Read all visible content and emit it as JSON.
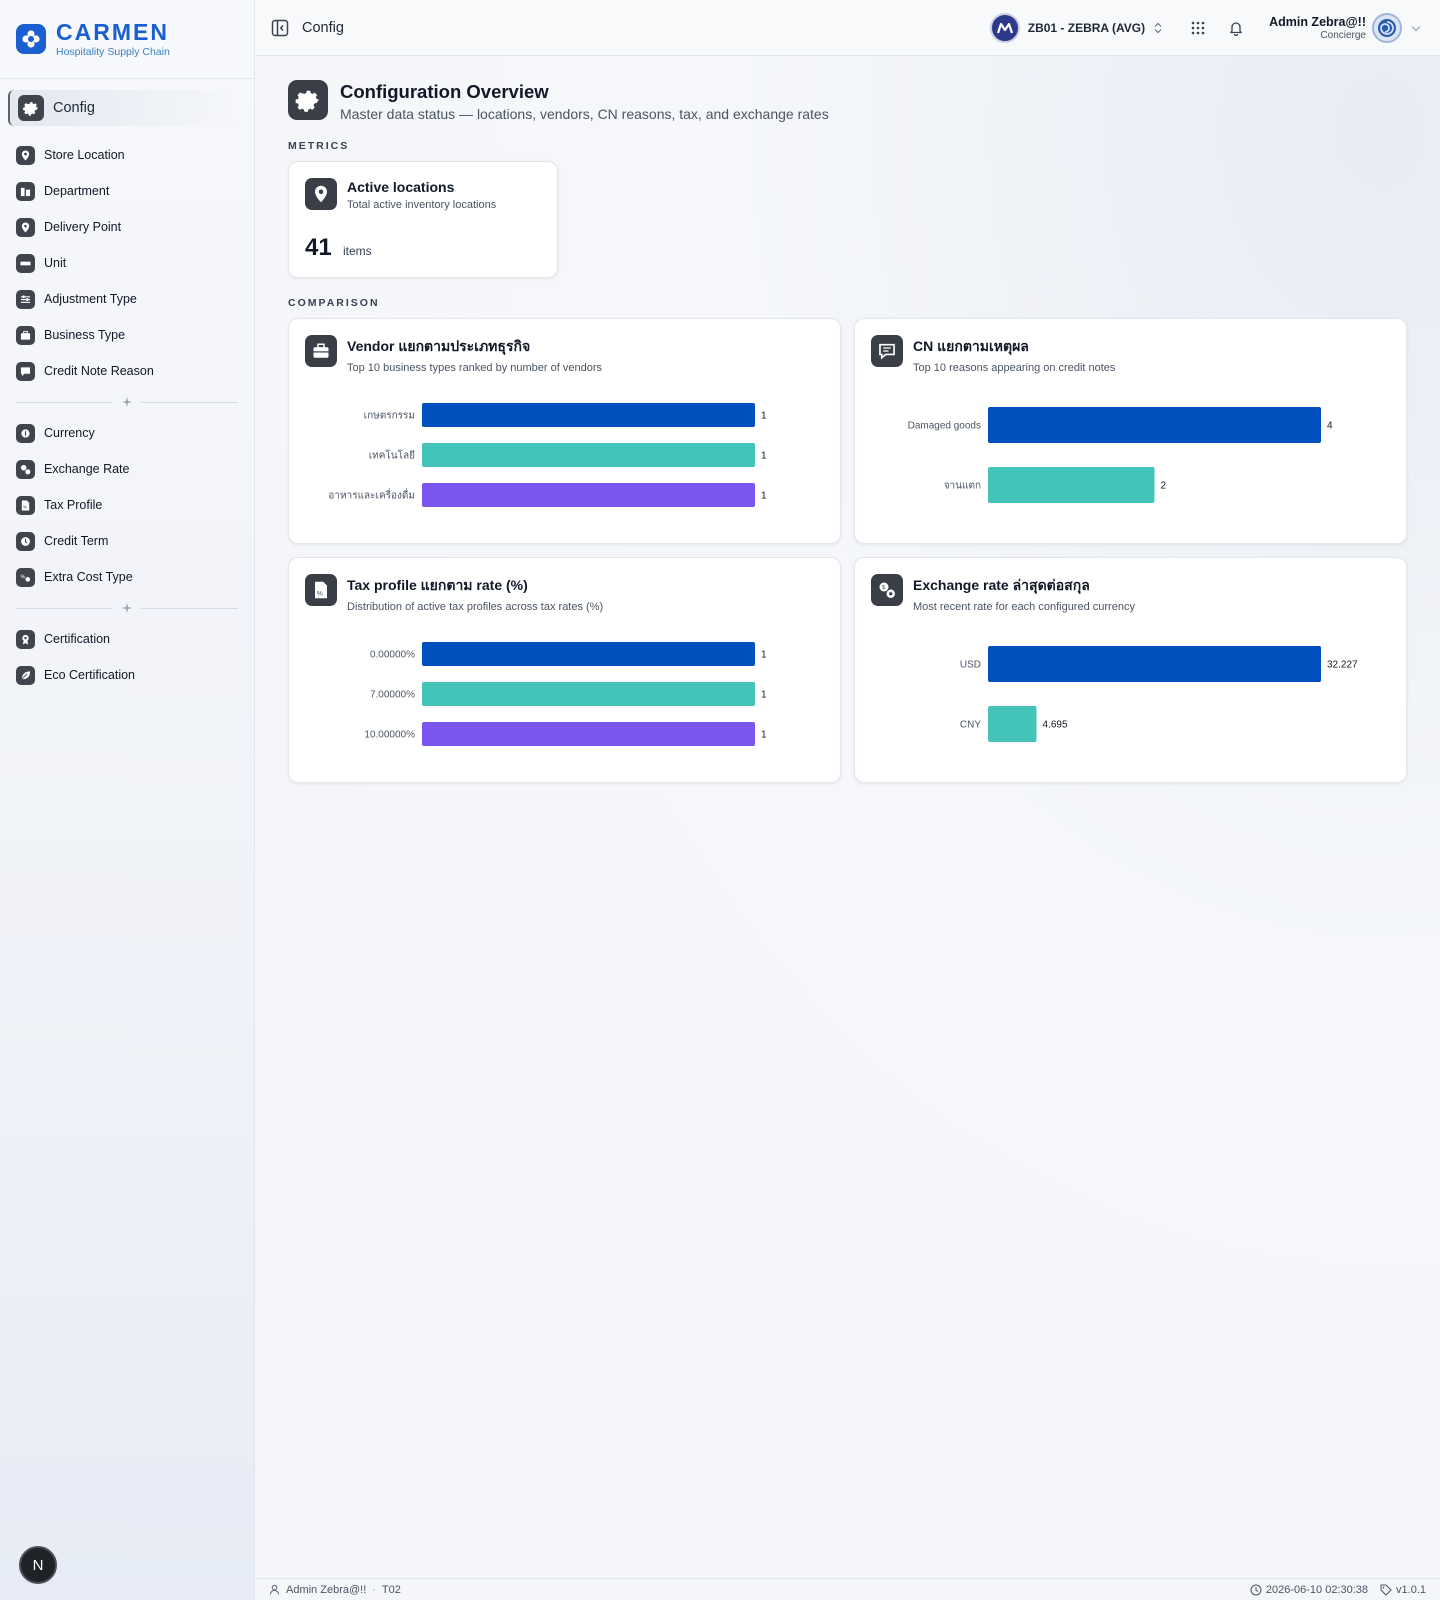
{
  "brand": {
    "name": "CARMEN",
    "tagline": "Hospitality Supply Chain"
  },
  "sidebar": {
    "active": {
      "label": "Config",
      "icon": "gear-icon"
    },
    "group1": [
      {
        "label": "Store Location",
        "icon": "map-pin-icon"
      },
      {
        "label": "Department",
        "icon": "department-icon"
      },
      {
        "label": "Delivery Point",
        "icon": "delivery-pin-icon"
      },
      {
        "label": "Unit",
        "icon": "ruler-icon"
      },
      {
        "label": "Adjustment Type",
        "icon": "sliders-icon"
      },
      {
        "label": "Business Type",
        "icon": "briefcase-icon"
      },
      {
        "label": "Credit Note Reason",
        "icon": "message-icon"
      }
    ],
    "group2": [
      {
        "label": "Currency",
        "icon": "coin-icon"
      },
      {
        "label": "Exchange Rate",
        "icon": "exchange-icon"
      },
      {
        "label": "Tax Profile",
        "icon": "percent-file-icon"
      },
      {
        "label": "Credit Term",
        "icon": "clock-icon"
      },
      {
        "label": "Extra Cost Type",
        "icon": "cost-icon"
      }
    ],
    "group3": [
      {
        "label": "Certification",
        "icon": "award-icon"
      },
      {
        "label": "Eco Certification",
        "icon": "leaf-icon"
      }
    ],
    "fab_label": "N"
  },
  "header": {
    "title": "Config",
    "business_unit": "ZB01 - ZEBRA (AVG)",
    "user_name": "Admin Zebra@!!",
    "user_role": "Concierge"
  },
  "page": {
    "title": "Configuration Overview",
    "subtitle": "Master data status — locations, vendors, CN reasons, tax, and exchange rates",
    "metrics_label": "METRICS",
    "comparison_label": "COMPARISON"
  },
  "metric": {
    "title": "Active locations",
    "subtitle": "Total active inventory locations",
    "value": "41",
    "unit": "items"
  },
  "colors": {
    "blue": "#0050c0",
    "teal": "#44c4b8",
    "purple": "#7b55f0",
    "icon_bg": "#3a3f47",
    "brand": "#1a5fd1"
  },
  "chart_data": [
    {
      "id": "vendor",
      "type": "bar",
      "orientation": "horizontal",
      "title": "Vendor แยกตามประเภทธุรกิจ",
      "subtitle": "Top 10 business types ranked by number of vendors",
      "icon": "briefcase-icon",
      "categories": [
        "เกษตรกรรม",
        "เทคโนโลยี",
        "อาหารและเครื่องดื่ม"
      ],
      "values": [
        1,
        1,
        1
      ],
      "value_labels": [
        "1",
        "1",
        "1"
      ],
      "colors": [
        "#0050c0",
        "#44c4b8",
        "#7b55f0"
      ],
      "xlim": [
        0,
        1
      ]
    },
    {
      "id": "cn",
      "type": "bar",
      "orientation": "horizontal",
      "title": "CN แยกตามเหตุผล",
      "subtitle": "Top 10 reasons appearing on credit notes",
      "icon": "message-icon",
      "categories": [
        "Damaged goods",
        "จานแตก"
      ],
      "values": [
        4,
        2
      ],
      "value_labels": [
        "4",
        "2"
      ],
      "colors": [
        "#0050c0",
        "#44c4b8"
      ],
      "xlim": [
        0,
        4
      ]
    },
    {
      "id": "tax",
      "type": "bar",
      "orientation": "horizontal",
      "title": "Tax profile แยกตาม rate (%)",
      "subtitle": "Distribution of active tax profiles across tax rates (%)",
      "icon": "percent-file-icon",
      "categories": [
        "0.00000%",
        "7.00000%",
        "10.00000%"
      ],
      "values": [
        1,
        1,
        1
      ],
      "value_labels": [
        "1",
        "1",
        "1"
      ],
      "colors": [
        "#0050c0",
        "#44c4b8",
        "#7b55f0"
      ],
      "xlim": [
        0,
        1
      ]
    },
    {
      "id": "fx",
      "type": "bar",
      "orientation": "horizontal",
      "title": "Exchange rate ล่าสุดต่อสกุล",
      "subtitle": "Most recent rate for each configured currency",
      "icon": "exchange-icon",
      "categories": [
        "USD",
        "CNY"
      ],
      "values": [
        32.227,
        4.695
      ],
      "value_labels": [
        "32.227",
        "4.695"
      ],
      "colors": [
        "#0050c0",
        "#44c4b8"
      ],
      "xlim": [
        0,
        32.227
      ]
    }
  ],
  "footer": {
    "user": "Admin Zebra@!!",
    "separator": "·",
    "code": "T02",
    "datetime": "2026-06-10 02:30:38",
    "version": "v1.0.1"
  }
}
